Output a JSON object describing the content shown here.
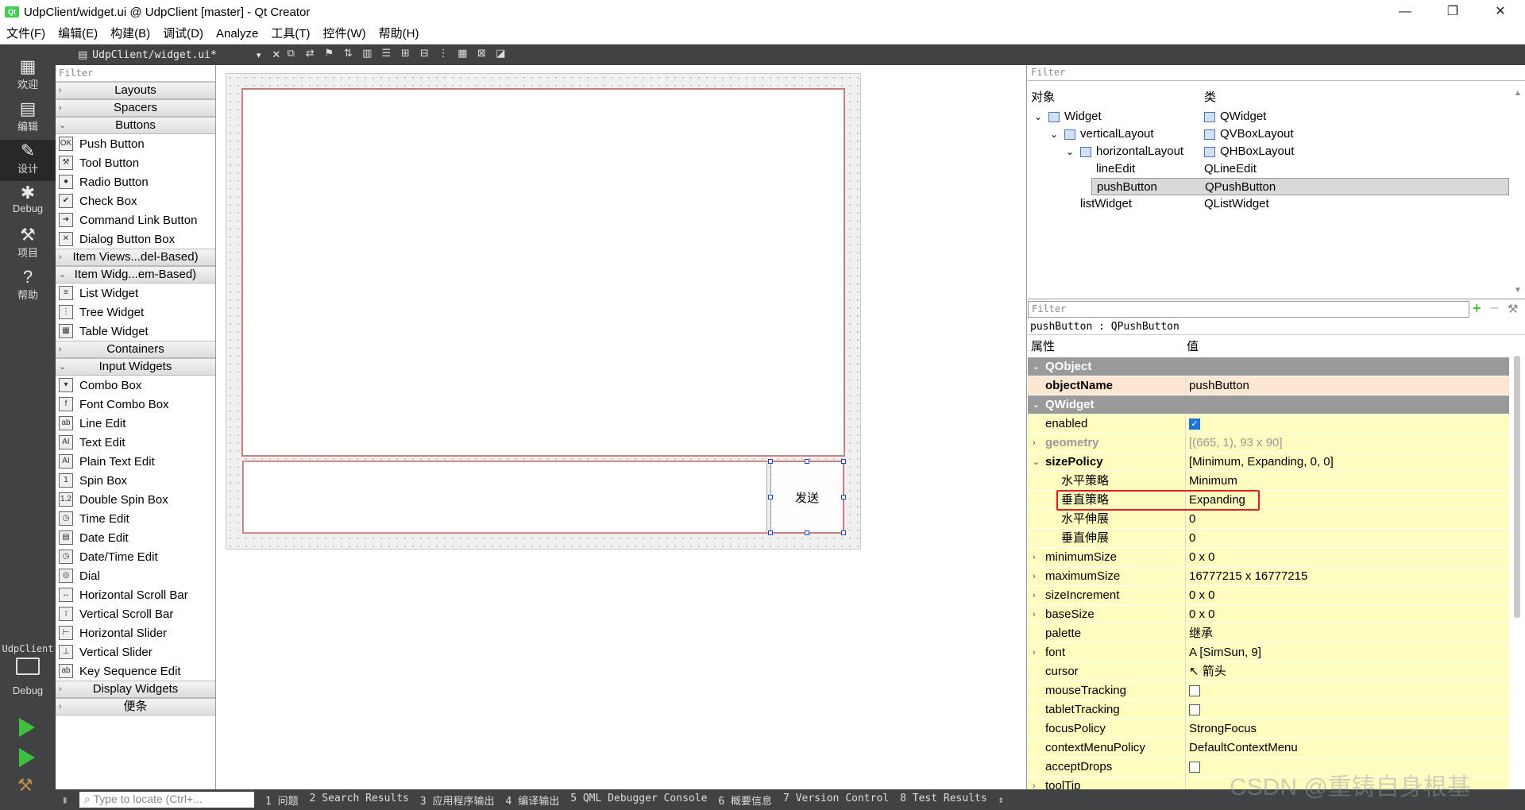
{
  "window": {
    "title": "UdpClient/widget.ui @ UdpClient [master] - Qt Creator",
    "minimize": "—",
    "maximize": "❐",
    "close": "✕"
  },
  "menu": [
    "文件(F)",
    "编辑(E)",
    "构建(B)",
    "调试(D)",
    "Analyze",
    "工具(T)",
    "控件(W)",
    "帮助(H)"
  ],
  "modes": [
    {
      "label": "欢迎",
      "icon": "grid-icon"
    },
    {
      "label": "编辑",
      "icon": "edit-icon"
    },
    {
      "label": "设计",
      "icon": "pencil-icon"
    },
    {
      "label": "Debug",
      "icon": "bug-icon"
    },
    {
      "label": "项目",
      "icon": "wrench-icon"
    },
    {
      "label": "帮助",
      "icon": "help-icon"
    }
  ],
  "kit": {
    "project": "UdpClient",
    "mode": "Debug"
  },
  "editor": {
    "document": "UdpClient/widget.ui*"
  },
  "widgetbox": {
    "filter": "Filter",
    "entries": [
      {
        "t": "cat",
        "label": "Layouts",
        "open": false
      },
      {
        "t": "cat",
        "label": "Spacers",
        "open": false
      },
      {
        "t": "cat",
        "label": "Buttons",
        "open": true
      },
      {
        "t": "item",
        "label": "Push Button",
        "icon": "OK"
      },
      {
        "t": "item",
        "label": "Tool Button",
        "icon": "⚒"
      },
      {
        "t": "item",
        "label": "Radio Button",
        "icon": "●"
      },
      {
        "t": "item",
        "label": "Check Box",
        "icon": "✔"
      },
      {
        "t": "item",
        "label": "Command Link Button",
        "icon": "➔"
      },
      {
        "t": "item",
        "label": "Dialog Button Box",
        "icon": "✕"
      },
      {
        "t": "cat",
        "label": "Item Views...del-Based)",
        "open": false
      },
      {
        "t": "cat",
        "label": "Item Widg...em-Based)",
        "open": true
      },
      {
        "t": "item",
        "label": "List Widget",
        "icon": "≡"
      },
      {
        "t": "item",
        "label": "Tree Widget",
        "icon": "⋮"
      },
      {
        "t": "item",
        "label": "Table Widget",
        "icon": "▦"
      },
      {
        "t": "cat",
        "label": "Containers",
        "open": false
      },
      {
        "t": "cat",
        "label": "Input Widgets",
        "open": true
      },
      {
        "t": "item",
        "label": "Combo Box",
        "icon": "▾"
      },
      {
        "t": "item",
        "label": "Font Combo Box",
        "icon": "f"
      },
      {
        "t": "item",
        "label": "Line Edit",
        "icon": "ab"
      },
      {
        "t": "item",
        "label": "Text Edit",
        "icon": "AI"
      },
      {
        "t": "item",
        "label": "Plain Text Edit",
        "icon": "AI"
      },
      {
        "t": "item",
        "label": "Spin Box",
        "icon": "1"
      },
      {
        "t": "item",
        "label": "Double Spin Box",
        "icon": "1.2"
      },
      {
        "t": "item",
        "label": "Time Edit",
        "icon": "◷"
      },
      {
        "t": "item",
        "label": "Date Edit",
        "icon": "▤"
      },
      {
        "t": "item",
        "label": "Date/Time Edit",
        "icon": "◷"
      },
      {
        "t": "item",
        "label": "Dial",
        "icon": "◎"
      },
      {
        "t": "item",
        "label": "Horizontal Scroll Bar",
        "icon": "↔"
      },
      {
        "t": "item",
        "label": "Vertical Scroll Bar",
        "icon": "↕"
      },
      {
        "t": "item",
        "label": "Horizontal Slider",
        "icon": "⊢"
      },
      {
        "t": "item",
        "label": "Vertical Slider",
        "icon": "⊥"
      },
      {
        "t": "item",
        "label": "Key Sequence Edit",
        "icon": "ab"
      },
      {
        "t": "cat",
        "label": "Display Widgets",
        "open": false
      },
      {
        "t": "cat",
        "label": "便条",
        "open": false
      }
    ]
  },
  "form": {
    "send_button": "发送"
  },
  "object_inspector": {
    "filter": "Filter",
    "col_object": "对象",
    "col_class": "类",
    "rows": [
      {
        "name": "Widget",
        "cls": "QWidget",
        "indent": 0,
        "exp": "⌄"
      },
      {
        "name": "verticalLayout",
        "cls": "QVBoxLayout",
        "indent": 1,
        "exp": "⌄"
      },
      {
        "name": "horizontalLayout",
        "cls": "QHBoxLayout",
        "indent": 2,
        "exp": "⌄"
      },
      {
        "name": "lineEdit",
        "cls": "QLineEdit",
        "indent": 3,
        "exp": ""
      },
      {
        "name": "pushButton",
        "cls": "QPushButton",
        "indent": 3,
        "exp": ""
      },
      {
        "name": "listWidget",
        "cls": "QListWidget",
        "indent": 2,
        "exp": ""
      }
    ]
  },
  "property_editor": {
    "filter": "Filter",
    "subtitle": "pushButton : QPushButton",
    "col_prop": "属性",
    "col_val": "值",
    "rows": [
      {
        "t": "grp",
        "name": "QObject"
      },
      {
        "t": "p",
        "name": "objectName",
        "val": "pushButton",
        "bold": true,
        "bg": "#fde6d2"
      },
      {
        "t": "grp",
        "name": "QWidget"
      },
      {
        "t": "p",
        "name": "enabled",
        "val": "",
        "chk": "on",
        "bg": "#fffcc0"
      },
      {
        "t": "p",
        "name": "geometry",
        "val": "[(665, 1), 93 x 90]",
        "bold": true,
        "dim": true,
        "ex": "›",
        "bg": "#fffcc0"
      },
      {
        "t": "p",
        "name": "sizePolicy",
        "val": "[Minimum, Expanding, 0, 0]",
        "bold": true,
        "ex": "⌄",
        "bg": "#fffcc0"
      },
      {
        "t": "p",
        "name": "水平策略",
        "val": "Minimum",
        "sub": true,
        "bg": "#fffcc0"
      },
      {
        "t": "p",
        "name": "垂直策略",
        "val": "Expanding",
        "sub": true,
        "hl": true,
        "bg": "#fffcc0"
      },
      {
        "t": "p",
        "name": "水平伸展",
        "val": "0",
        "sub": true,
        "bg": "#fffcc0"
      },
      {
        "t": "p",
        "name": "垂直伸展",
        "val": "0",
        "sub": true,
        "bg": "#fffcc0"
      },
      {
        "t": "p",
        "name": "minimumSize",
        "val": "0 x 0",
        "ex": "›",
        "bg": "#fffcc0"
      },
      {
        "t": "p",
        "name": "maximumSize",
        "val": "16777215 x 16777215",
        "ex": "›",
        "bg": "#fffcc0"
      },
      {
        "t": "p",
        "name": "sizeIncrement",
        "val": "0 x 0",
        "ex": "›",
        "bg": "#fffcc0"
      },
      {
        "t": "p",
        "name": "baseSize",
        "val": "0 x 0",
        "ex": "›",
        "bg": "#fffcc0"
      },
      {
        "t": "p",
        "name": "palette",
        "val": "继承",
        "bg": "#fffcc0"
      },
      {
        "t": "p",
        "name": "font",
        "val": "A [SimSun, 9]",
        "ex": "›",
        "bg": "#fffcc0"
      },
      {
        "t": "p",
        "name": "cursor",
        "val": "↖ 箭头",
        "bg": "#fffcc0"
      },
      {
        "t": "p",
        "name": "mouseTracking",
        "val": "",
        "chk": "off",
        "bg": "#fffcc0"
      },
      {
        "t": "p",
        "name": "tabletTracking",
        "val": "",
        "chk": "off",
        "bg": "#fffcc0"
      },
      {
        "t": "p",
        "name": "focusPolicy",
        "val": "StrongFocus",
        "bg": "#fffcc0"
      },
      {
        "t": "p",
        "name": "contextMenuPolicy",
        "val": "DefaultContextMenu",
        "bg": "#fffcc0"
      },
      {
        "t": "p",
        "name": "acceptDrops",
        "val": "",
        "chk": "off",
        "bg": "#fffcc0"
      },
      {
        "t": "p",
        "name": "toolTip",
        "val": "",
        "ex": "›",
        "bg": "#fffcc0"
      }
    ]
  },
  "statusbar": {
    "locate": "Type to locate (Ctrl+...",
    "panes": [
      "1 问题",
      "2 Search Results",
      "3 应用程序输出",
      "4 编译输出",
      "5 QML Debugger Console",
      "6 概要信息",
      "7 Version Control",
      "8 Test Results"
    ]
  },
  "watermark": "CSDN @重铸自身根基"
}
